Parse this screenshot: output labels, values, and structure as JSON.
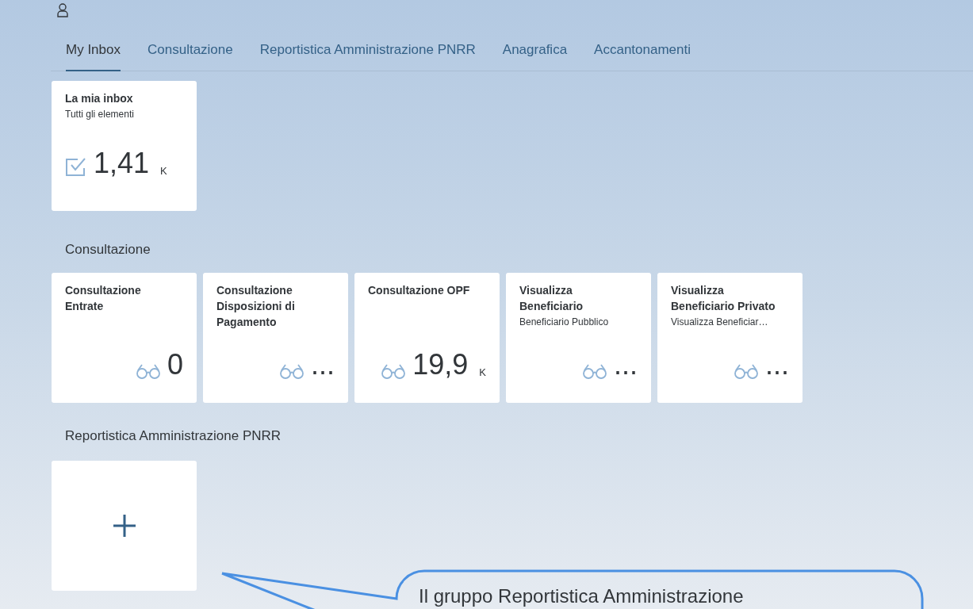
{
  "tabs": [
    {
      "label": "My Inbox",
      "selected": true
    },
    {
      "label": "Consultazione",
      "selected": false
    },
    {
      "label": "Reportistica Amministrazione PNRR",
      "selected": false
    },
    {
      "label": "Anagrafica",
      "selected": false
    },
    {
      "label": "Accantonamenti",
      "selected": false
    }
  ],
  "groups": [
    {
      "tiles": [
        {
          "kind": "inbox",
          "title": "La mia inbox",
          "subtitle": "Tutti gli elementi",
          "value": "1,41",
          "unit": "K"
        }
      ]
    },
    {
      "title": "Consultazione",
      "tiles": [
        {
          "kind": "app",
          "title": "Consultazione Entrate",
          "value": "0"
        },
        {
          "kind": "app",
          "title": "Consultazione Disposizioni di Pagamento",
          "value": "..."
        },
        {
          "kind": "app",
          "title": "Consultazione OPF",
          "value": "19,9",
          "unit": "K"
        },
        {
          "kind": "app",
          "title": "Visualizza Beneficiario",
          "subtitle": "Beneficiario Pubblico",
          "value": "..."
        },
        {
          "kind": "app",
          "title": "Visualizza Beneficiario Privato",
          "subtitle": "Visualizza Beneficiar…",
          "value": "..."
        }
      ]
    },
    {
      "title": "Reportistica Amministrazione PNRR",
      "tiles": [
        {
          "kind": "add"
        }
      ]
    }
  ],
  "callout": {
    "text": "Il gruppo Reportistica Amministrazione"
  }
}
